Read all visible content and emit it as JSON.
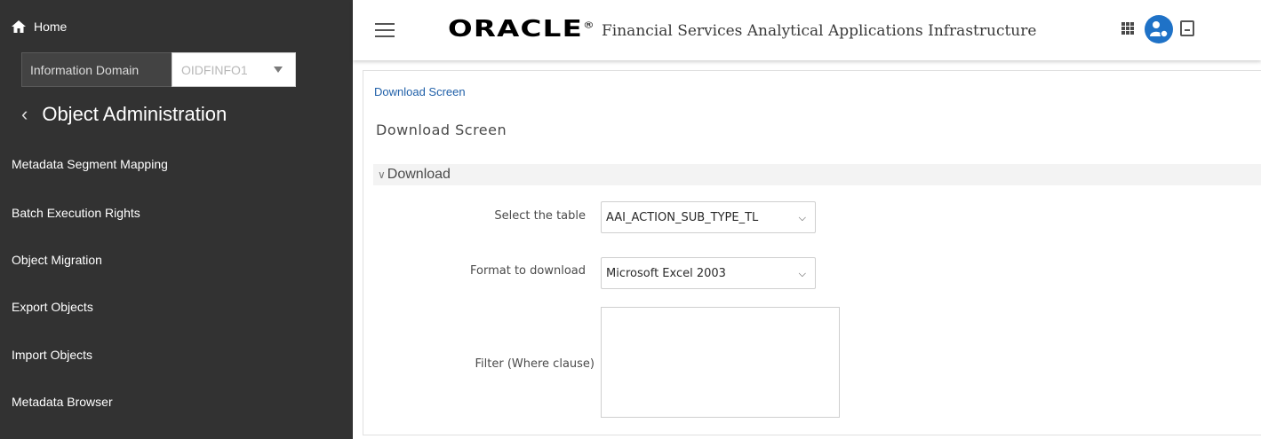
{
  "sidebar": {
    "home_label": "Home",
    "info_domain_label": "Information Domain",
    "info_domain_value": "OIDFINFO1",
    "section_title": "Object Administration",
    "items": [
      {
        "label": "Metadata Segment Mapping"
      },
      {
        "label": "Batch Execution Rights"
      },
      {
        "label": "Object Migration"
      },
      {
        "label": "Export Objects"
      },
      {
        "label": "Import Objects"
      },
      {
        "label": "Metadata Browser"
      }
    ]
  },
  "header": {
    "logo": "ORACLE",
    "product_name": "Financial Services Analytical Applications Infrastructure",
    "icons": [
      "menu-icon",
      "apps-grid-icon",
      "user-icon",
      "document-icon"
    ]
  },
  "main": {
    "breadcrumb": "Download Screen",
    "page_title": "Download Screen",
    "section_label": "Download",
    "form": {
      "table_label": "Select the table",
      "table_value": "AAI_ACTION_SUB_TYPE_TL",
      "format_label": "Format to download",
      "format_value": "Microsoft Excel 2003",
      "filter_label": "Filter (Where clause)",
      "filter_value": ""
    }
  },
  "colors": {
    "sidebar_bg": "#323232",
    "accent": "#1f72c7",
    "link": "#1f5fa8"
  }
}
